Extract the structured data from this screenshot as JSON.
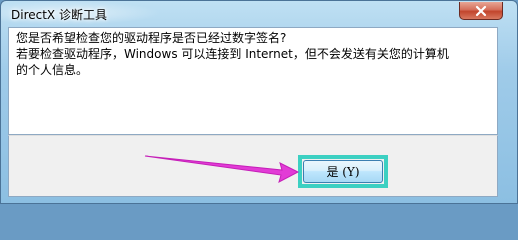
{
  "window": {
    "title": "DirectX 诊断工具"
  },
  "message": {
    "line1": "您是否希望检查您的驱动程序是否已经过数字签名?",
    "line2": "若要检查驱动程序，Windows 可以连接到 Internet，但不会发送有关您的计算机",
    "line3": "的个人信息。"
  },
  "buttons": {
    "yes_label": "是 (Y)"
  },
  "icons": {
    "close": "close-icon",
    "annotation_arrow": "arrow-icon"
  },
  "colors": {
    "highlight_box": "#3cd0c2",
    "annotation_arrow": "#e23bd6",
    "close_button": "#c2452c"
  }
}
